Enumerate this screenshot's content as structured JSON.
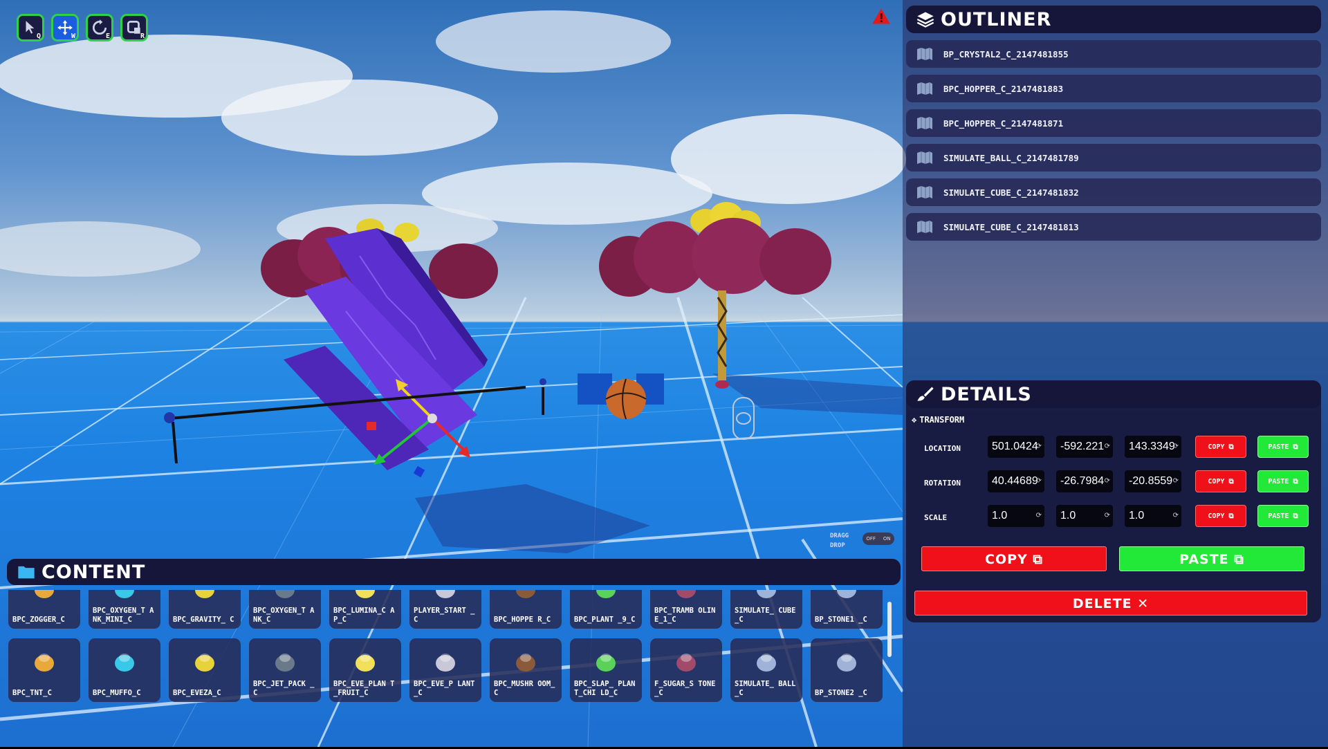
{
  "toolbar": {
    "tools": [
      {
        "name": "select",
        "key": "Q",
        "icon": "cursor-icon"
      },
      {
        "name": "move",
        "key": "W",
        "icon": "move-arrows-icon"
      },
      {
        "name": "rotate",
        "key": "E",
        "icon": "rotate-icon"
      },
      {
        "name": "scale",
        "key": "R",
        "icon": "scale-icon"
      }
    ],
    "active_tool": "move"
  },
  "outliner": {
    "title": "OUTLINER",
    "items": [
      "BP_CRYSTAL2_C_2147481855",
      "BPC_HOPPER_C_2147481883",
      "BPC_HOPPER_C_2147481871",
      "SIMULATE_BALL_C_2147481789",
      "SIMULATE_CUBE_C_2147481832",
      "SIMULATE_CUBE_C_2147481813"
    ]
  },
  "details": {
    "title": "DETAILS",
    "section": "TRANSFORM",
    "rows": [
      {
        "label": "LOCATION",
        "x": "501.0424",
        "y": "-592.221",
        "z": "143.3349"
      },
      {
        "label": "ROTATION",
        "x": "40.44689",
        "y": "-26.7984",
        "z": "-20.8559"
      },
      {
        "label": "SCALE",
        "x": "1.0",
        "y": "1.0",
        "z": "1.0"
      }
    ],
    "mini_copy": "COPY",
    "mini_paste": "PASTE",
    "copy": "COPY",
    "paste": "PASTE",
    "delete": "DELETE"
  },
  "drag_drop": {
    "label_line1": "DRAGG",
    "label_line2": "DROP",
    "off": "OFF",
    "on": "ON"
  },
  "content": {
    "title": "CONTENT",
    "row1": [
      "BPC_ZOGGER_C",
      "BPC_OXYGEN_TANK_MINI_C",
      "BPC_GRAVITY_C",
      "BPC_OXYGEN_TANK_C",
      "BPC_LUMINA_CAP_C",
      "PLAYER_START_C",
      "BPC_HOPPER_C",
      "BPC_PLANT_9_C",
      "BPC_TRAMBOLINE_1_C",
      "SIMULATE_CUBE_C",
      "BP_STONE1_C"
    ],
    "row2": [
      "BPC_TNT_C",
      "BPC_MUFFO_C",
      "BPC_EVEZA_C",
      "BPC_JET_PACK_C",
      "BPC_EVE_PLANT_FRUIT_C",
      "BPC_EVE_PLANT_C",
      "BPC_MUSHROOM_C",
      "BPC_SLAP_PLANT_CHILD_C",
      "F_SUGAR_STONE_C",
      "SIMULATE_BALL_C",
      "BP_STONE2_C"
    ],
    "row1_display": [
      "BPC_ZOGGER_C",
      "BPC_OXYGEN_T ANK_MINI_C",
      "BPC_GRAVITY_ C",
      "BPC_OXYGEN_T ANK_C",
      "BPC_LUMINA_C AP_C",
      "PLAYER_START _C",
      "BPC_HOPPE R_C",
      "BPC_PLANT _9_C",
      "BPC_TRAMB OLINE_1_C",
      "SIMULATE_ CUBE_C",
      "BP_STONE1 _C"
    ],
    "row2_display": [
      "BPC_TNT_C",
      "BPC_MUFFO_C",
      "BPC_EVEZA_C",
      "BPC_JET_PACK _C",
      "BPC_EVE_PLAN T_FRUIT_C",
      "BPC_EVE_P LANT_C",
      "BPC_MUSHR OOM_C",
      "BPC_SLAP_ PLANT_CHI LD_C",
      "F_SUGAR_S TONE_C",
      "SIMULATE_ BALL_C",
      "BP_STONE2 _C"
    ]
  },
  "colors": {
    "panel_dark": "#15163a",
    "copy_red": "#f0101a",
    "paste_green": "#22e838",
    "tool_border_green": "#2fd14a",
    "tool_active_blue": "#1a5de0"
  }
}
